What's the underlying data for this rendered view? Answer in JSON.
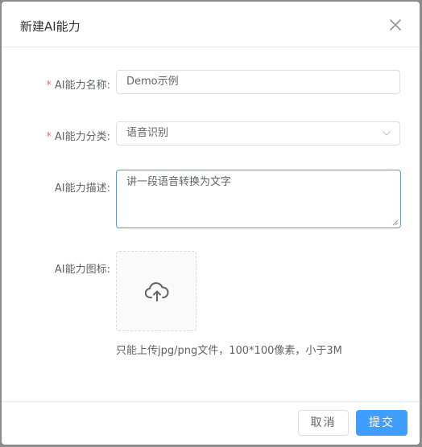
{
  "dialog": {
    "title": "新建AI能力",
    "close_icon": "close-icon"
  },
  "form": {
    "name": {
      "required_mark": "*",
      "label": "AI能力名称:",
      "value": "Demo示例"
    },
    "category": {
      "required_mark": "*",
      "label": "AI能力分类:",
      "value": "语音识别",
      "icon": "chevron-down-icon"
    },
    "description": {
      "label": "AI能力描述:",
      "value": "讲一段语音转换为文字"
    },
    "icon": {
      "label": "AI能力图标:",
      "upload_icon": "cloud-upload-icon",
      "hint": "只能上传jpg/png文件，100*100像素，小于3M"
    }
  },
  "footer": {
    "cancel_label": "取消",
    "submit_label": "提交"
  },
  "colors": {
    "primary": "#409eff",
    "required": "#f56c6c",
    "border": "#dcdfe6",
    "text": "#606266"
  }
}
